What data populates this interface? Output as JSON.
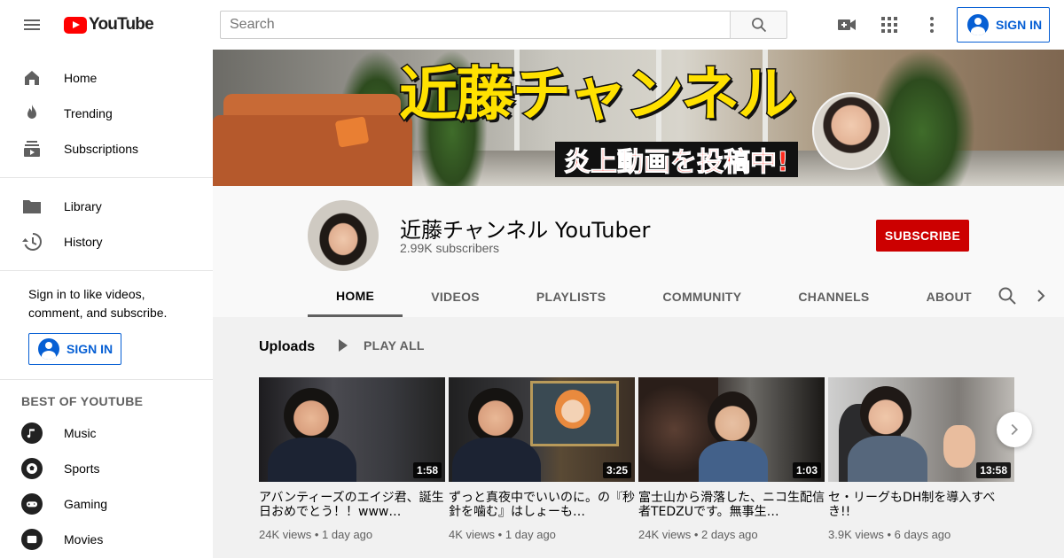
{
  "topbar": {
    "logo_text": "YouTube",
    "search_placeholder": "Search",
    "signin_label": "SIGN IN"
  },
  "sidebar": {
    "main_items": [
      {
        "label": "Home",
        "icon": "home-icon"
      },
      {
        "label": "Trending",
        "icon": "trending-icon"
      },
      {
        "label": "Subscriptions",
        "icon": "subscriptions-icon"
      }
    ],
    "library_items": [
      {
        "label": "Library",
        "icon": "library-icon"
      },
      {
        "label": "History",
        "icon": "history-icon"
      }
    ],
    "signin_prompt": "Sign in to like videos, comment, and subscribe.",
    "signin_label": "SIGN IN",
    "best_of_title": "BEST OF YOUTUBE",
    "best_of_items": [
      {
        "label": "Music",
        "icon": "music-icon"
      },
      {
        "label": "Sports",
        "icon": "sports-icon"
      },
      {
        "label": "Gaming",
        "icon": "gaming-icon"
      },
      {
        "label": "Movies",
        "icon": "movies-icon"
      }
    ]
  },
  "banner": {
    "title": "近藤チャンネル",
    "subtitle": "炎上動画を投稿中!"
  },
  "channel": {
    "name": "近藤チャンネル YouTuber",
    "subscribers": "2.99K subscribers",
    "subscribe_label": "SUBSCRIBE",
    "tabs": [
      "HOME",
      "VIDEOS",
      "PLAYLISTS",
      "COMMUNITY",
      "CHANNELS",
      "ABOUT"
    ],
    "active_tab": "HOME"
  },
  "uploads": {
    "title": "Uploads",
    "play_all_label": "PLAY ALL",
    "videos": [
      {
        "title": "アバンティーズのエイジ君、誕生日おめでとう！！www…",
        "duration": "1:58",
        "views": "24K views",
        "age": "1 day ago"
      },
      {
        "title": "ずっと真夜中でいいのに。の『秒針を噛む』はしょーも…",
        "duration": "3:25",
        "views": "4K views",
        "age": "1 day ago"
      },
      {
        "title": "富士山から滑落した、ニコ生配信者TEDZUです。無事生…",
        "duration": "1:03",
        "views": "24K views",
        "age": "2 days ago"
      },
      {
        "title": "セ・リーグもDH制を導入すべき!!",
        "duration": "13:58",
        "views": "3.9K views",
        "age": "6 days ago"
      }
    ]
  },
  "colors": {
    "accent_blue": "#065fd4",
    "subscribe_red": "#cc0000",
    "logo_red": "#ff0000"
  }
}
